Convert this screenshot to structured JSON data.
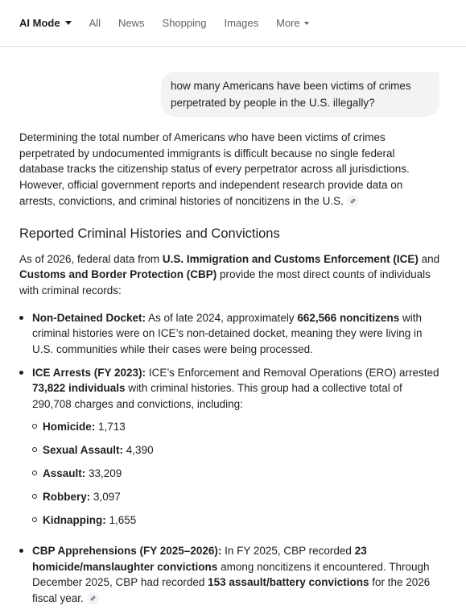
{
  "tabs": [
    {
      "label": "AI Mode",
      "active": true
    },
    {
      "label": "All"
    },
    {
      "label": "News"
    },
    {
      "label": "Shopping"
    },
    {
      "label": "Images"
    },
    {
      "label": "More"
    }
  ],
  "query": "how many Americans have been victims of crimes perpetrated by people in the U.S. illegally?",
  "intro": "Determining the total number of Americans who have been victims of crimes perpetrated by undocumented immigrants is difficult because no single federal database tracks the citizenship status of every perpetrator across all jurisdictions. However, official government reports and independent research provide data on arrests, convictions, and criminal histories of noncitizens in the U.S.",
  "section_heading": "Reported Criminal Histories and Convictions",
  "lead": {
    "t1": "As of 2026, federal data from ",
    "b1": "U.S. Immigration and Customs Enforcement (ICE)",
    "t2": " and ",
    "b2": "Customs and Border Protection (CBP)",
    "t3": " provide the most direct counts of individuals with criminal records:"
  },
  "bullets": {
    "docket": {
      "label": "Non-Detained Docket:",
      "t1": " As of late 2024, approximately ",
      "b1": "662,566 noncitizens",
      "t2": " with criminal histories were on ICE’s non-detained docket, meaning they were living in U.S. communities while their cases were being processed."
    },
    "ice": {
      "label": "ICE Arrests (FY 2023):",
      "t1": " ICE’s Enforcement and Removal Operations (ERO) arrested ",
      "b1": "73,822 individuals",
      "t2": " with criminal histories. This group had a collective total of 290,708 charges and convictions, including:",
      "items": [
        {
          "label": "Homicide:",
          "value": " 1,713"
        },
        {
          "label": "Sexual Assault:",
          "value": " 4,390"
        },
        {
          "label": "Assault:",
          "value": " 33,209"
        },
        {
          "label": "Robbery:",
          "value": " 3,097"
        },
        {
          "label": "Kidnapping:",
          "value": " 1,655"
        }
      ]
    },
    "cbp": {
      "label": "CBP Apprehensions (FY 2025–2026):",
      "t1": " In FY 2025, CBP recorded ",
      "b1": "23 homicide/manslaughter convictions",
      "t2": " among noncitizens it encountered. Through December 2025, CBP had recorded ",
      "b2": "153 assault/battery convictions",
      "t3": " for the 2026 fiscal year."
    }
  },
  "icons": {
    "link": "link-icon",
    "tab_dropdown": "chevron-down-icon"
  }
}
